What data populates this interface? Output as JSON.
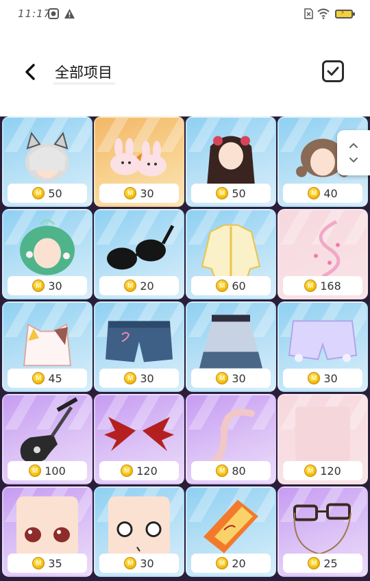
{
  "status": {
    "time": "11:17"
  },
  "header": {
    "title": "全部项目"
  },
  "icons": {
    "back": "back-icon",
    "select": "checkbox-checked-icon",
    "coin": "coin-icon",
    "scroll": "scroll-updown-icon"
  },
  "colors": {
    "coin": "#f2b705",
    "grid_bg": "#2a1e3a"
  },
  "items": [
    {
      "name": "silver-cat-ear-hair",
      "price": "50",
      "bg": "blue"
    },
    {
      "name": "bunny-slippers",
      "price": "30",
      "bg": "orange"
    },
    {
      "name": "black-long-hair-red-flower",
      "price": "50",
      "bg": "blue"
    },
    {
      "name": "brown-braided-hair",
      "price": "40",
      "bg": "blue"
    },
    {
      "name": "green-flower-hair",
      "price": "30",
      "bg": "blue"
    },
    {
      "name": "black-sunglasses",
      "price": "20",
      "bg": "blue"
    },
    {
      "name": "yellow-jacket",
      "price": "60",
      "bg": "blue"
    },
    {
      "name": "pink-sparkle-ribbon",
      "price": "168",
      "bg": "pink"
    },
    {
      "name": "white-camisole",
      "price": "45",
      "bg": "blue"
    },
    {
      "name": "denim-shorts",
      "price": "30",
      "bg": "blue"
    },
    {
      "name": "white-gradient-skirt",
      "price": "30",
      "bg": "blue"
    },
    {
      "name": "lavender-bloomers",
      "price": "30",
      "bg": "blue"
    },
    {
      "name": "electric-guitar",
      "price": "100",
      "bg": "purple"
    },
    {
      "name": "devil-wings",
      "price": "120",
      "bg": "purple"
    },
    {
      "name": "pink-tail",
      "price": "80",
      "bg": "purple"
    },
    {
      "name": "pink-item",
      "price": "120",
      "bg": "pink"
    },
    {
      "name": "red-eyes-face",
      "price": "35",
      "bg": "purple"
    },
    {
      "name": "round-eyes-face",
      "price": "30",
      "bg": "blue"
    },
    {
      "name": "talisman-paper",
      "price": "20",
      "bg": "blue"
    },
    {
      "name": "glasses-with-chain",
      "price": "25",
      "bg": "purple"
    }
  ]
}
